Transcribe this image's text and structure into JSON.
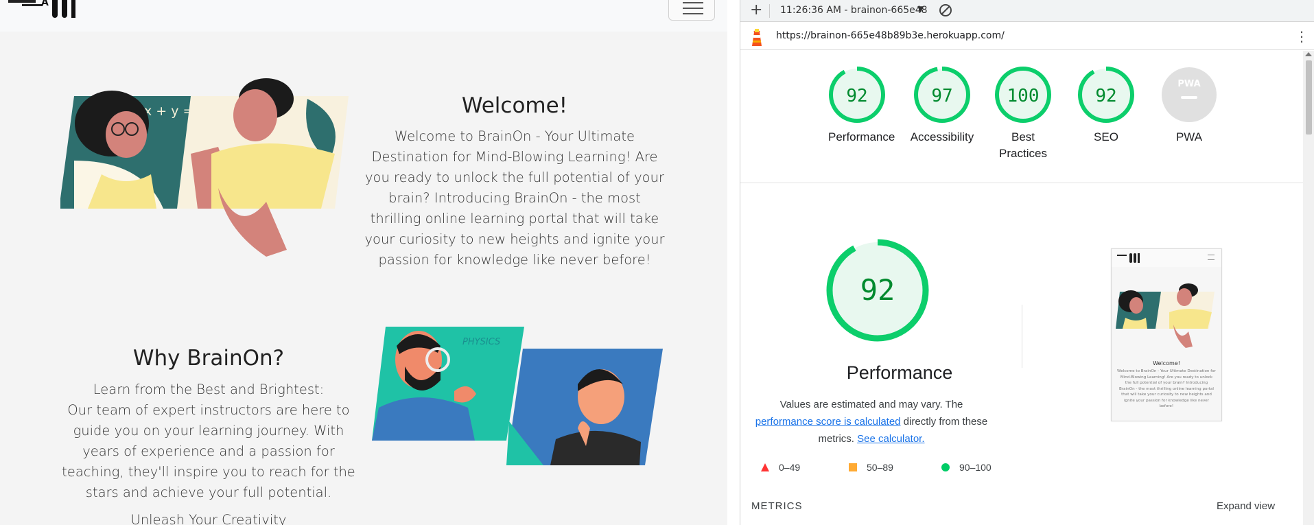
{
  "site": {
    "welcome": {
      "heading": "Welcome!",
      "lines": [
        "Welcome to BrainOn - Your Ultimate",
        "Destination for Mind-Blowing Learning! Are",
        "you ready to unlock the full potential of your",
        "brain? Introducing BrainOn - the most",
        "thrilling online learning portal that will take",
        "your curiosity to new heights and ignite your",
        "passion for knowledge like never before!"
      ]
    },
    "why": {
      "heading": "Why BrainOn?",
      "lines": [
        "Learn from the Best and Brightest:",
        "Our team of expert instructors are here to",
        "guide you on your learning journey. With",
        "years of experience and a passion for",
        "teaching, they'll inspire you to reach for the",
        "stars and achieve your full potential."
      ],
      "cut_line": "Unleash Your Creativity"
    },
    "illustration_texts": {
      "board_equation": "x + y = a",
      "physics_label": "PHYSICS"
    }
  },
  "devtools": {
    "report_selector": "11:26:36 AM - brainon-665e48",
    "url": "https://brainon-665e48b89b3e.herokuapp.com/",
    "pwa_badge": "PWA",
    "categories": [
      {
        "label": "Performance",
        "score": 92
      },
      {
        "label": "Accessibility",
        "score": 97
      },
      {
        "label": "Best Practices",
        "score": 100
      },
      {
        "label": "SEO",
        "score": 92
      },
      {
        "label": "PWA",
        "score": null
      }
    ],
    "performance": {
      "title": "Performance",
      "score": 92,
      "desc_prefix": "Values are estimated and may vary. The ",
      "desc_link1": "performance score is calculated",
      "desc_middle": " directly from these metrics. ",
      "desc_link2": "See calculator."
    },
    "legend": [
      {
        "range": "0–49",
        "color": "#ff3333",
        "shape": "triangle"
      },
      {
        "range": "50–89",
        "color": "#ffaa33",
        "shape": "square"
      },
      {
        "range": "90–100",
        "color": "#00cc66",
        "shape": "circle"
      }
    ],
    "metrics_label": "METRICS",
    "expand_label": "Expand view",
    "thumbnail": {
      "title": "Welcome!",
      "text": "Welcome to BrainOn - Your Ultimate Destination for Mind-Blowing Learning! Are you ready to unlock the full potential of your brain? Introducing BrainOn - the most thrilling online learning portal that will take your curiosity to new heights and ignite your passion for knowledge like never before!"
    },
    "colors": {
      "pass": "#0cce6b",
      "pass_bg": "#e8f8ef",
      "pass_text": "#008a2e",
      "link": "#1a73e8"
    }
  }
}
